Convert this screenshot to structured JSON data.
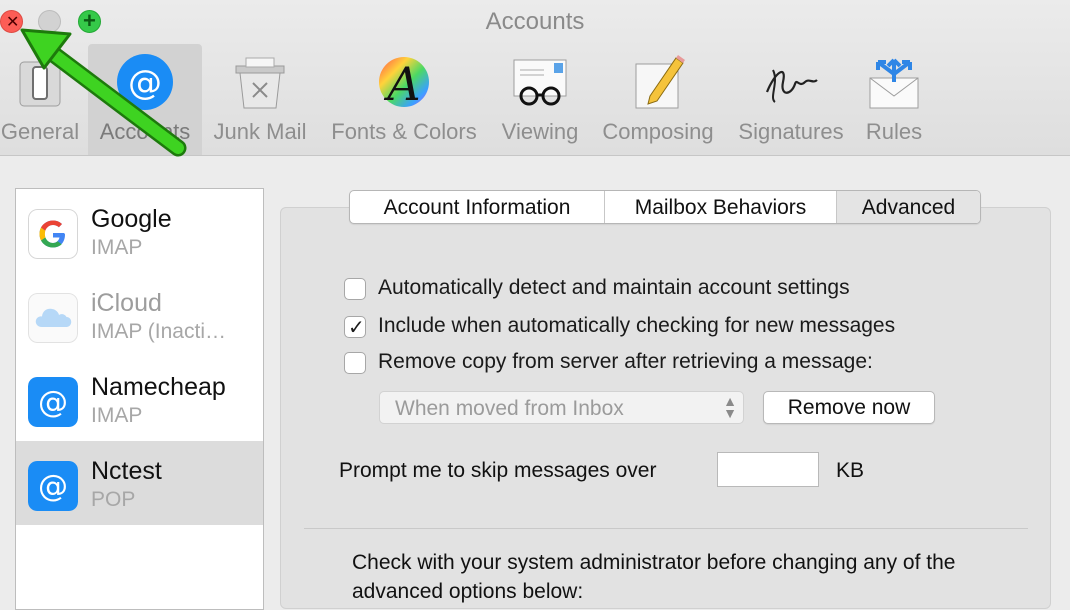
{
  "window": {
    "title": "Accounts"
  },
  "toolbar": {
    "items": [
      {
        "label": "General",
        "icon": "general-switch-icon"
      },
      {
        "label": "Accounts",
        "icon": "at-sign-icon"
      },
      {
        "label": "Junk Mail",
        "icon": "trash-can-icon"
      },
      {
        "label": "Fonts & Colors",
        "icon": "font-a-icon"
      },
      {
        "label": "Viewing",
        "icon": "glasses-envelope-icon"
      },
      {
        "label": "Composing",
        "icon": "pencil-paper-icon"
      },
      {
        "label": "Signatures",
        "icon": "signature-icon"
      },
      {
        "label": "Rules",
        "icon": "rules-envelope-arrows-icon"
      }
    ],
    "selected": "Accounts"
  },
  "accounts": [
    {
      "name": "Google",
      "type": "IMAP",
      "icon": "google-icon"
    },
    {
      "name": "iCloud",
      "type": "IMAP (Inacti…",
      "icon": "icloud-icon"
    },
    {
      "name": "Namecheap",
      "type": "IMAP",
      "icon": "at-sign-icon"
    },
    {
      "name": "Nctest",
      "type": "POP",
      "icon": "at-sign-icon"
    }
  ],
  "tabs": [
    {
      "label": "Account Information"
    },
    {
      "label": "Mailbox Behaviors"
    },
    {
      "label": "Advanced"
    }
  ],
  "selected_tab": "Advanced",
  "options": {
    "auto_detect": {
      "label": "Automatically detect and maintain account settings",
      "checked": false
    },
    "include_check": {
      "label": "Include when automatically checking for new messages",
      "checked": true
    },
    "remove_copy": {
      "label": "Remove copy from server after retrieving a message:",
      "checked": false
    }
  },
  "remove_select": {
    "value": "When moved from Inbox"
  },
  "remove_now_label": "Remove now",
  "prompt_label": "Prompt me to skip messages over",
  "prompt_value": "",
  "prompt_unit": "KB",
  "note": "Check with your system administrator before changing any of the advanced options below:",
  "colors": {
    "accent": "#1a8cf5",
    "annotation_arrow": "#3ed321",
    "close": "#fc5d56",
    "maximize": "#35c949"
  }
}
